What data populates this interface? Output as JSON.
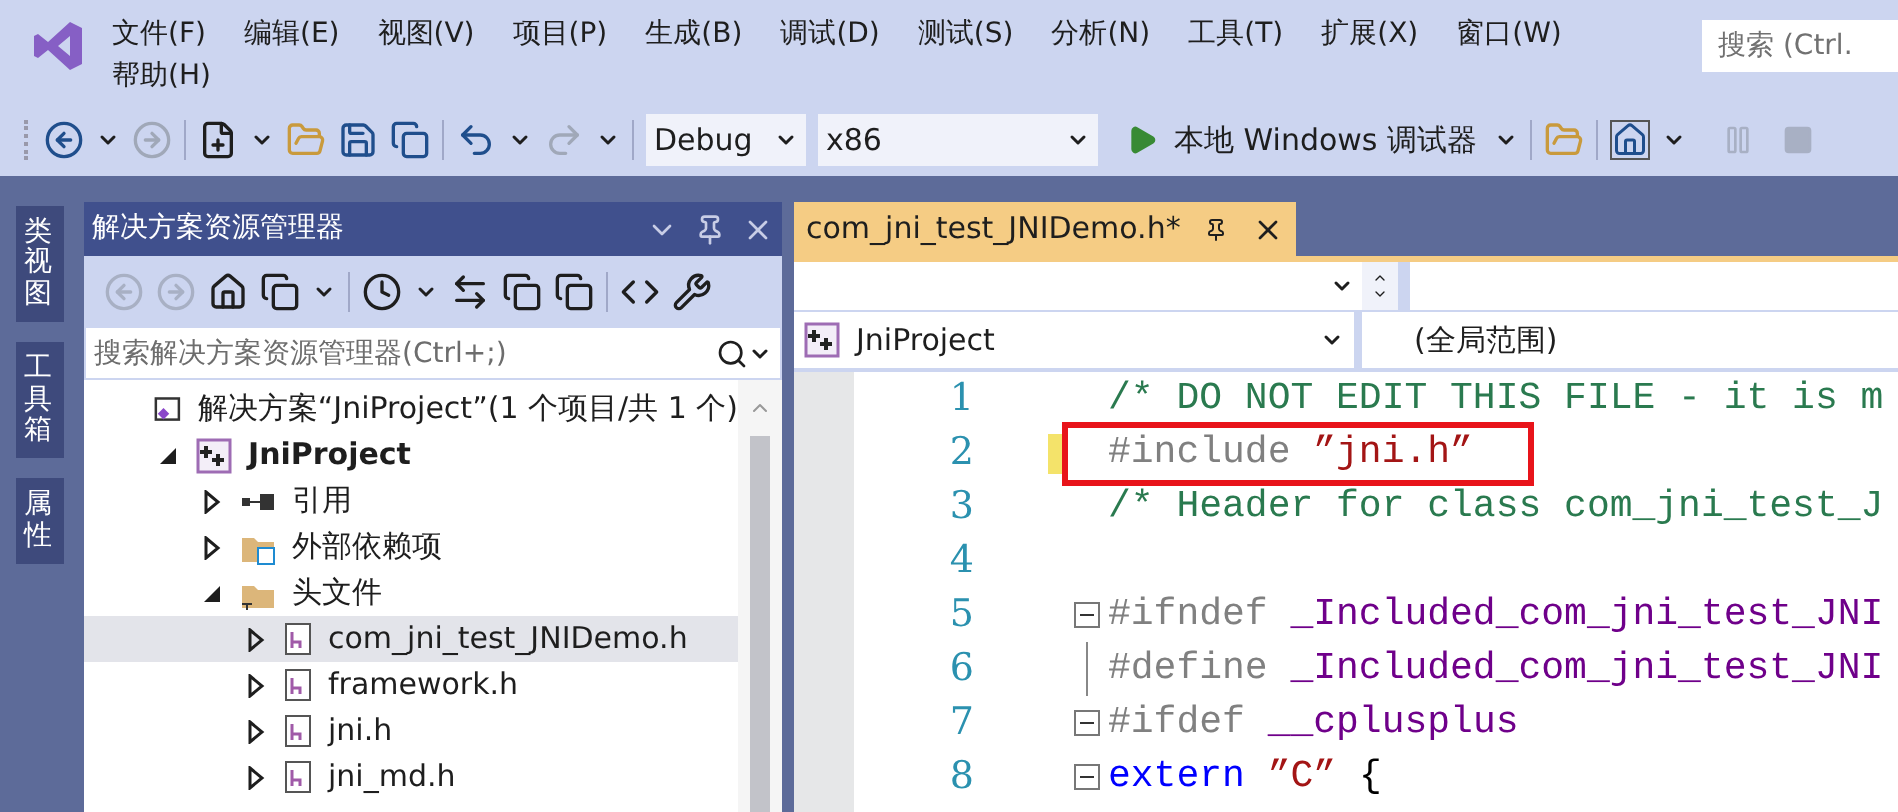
{
  "menu": [
    "文件(F)",
    "编辑(E)",
    "视图(V)",
    "项目(P)",
    "生成(B)",
    "调试(D)",
    "测试(S)",
    "分析(N)",
    "工具(T)",
    "扩展(X)",
    "窗口(W)",
    "帮助(H)"
  ],
  "search": {
    "placeholder": "搜索 (Ctrl."
  },
  "toolbar": {
    "configuration": "Debug",
    "platform": "x86",
    "run_label": "本地 Windows 调试器"
  },
  "side_tabs": [
    "类视图",
    "工具箱",
    "属性"
  ],
  "solution_explorer": {
    "title": "解决方案资源管理器",
    "search_placeholder": "搜索解决方案资源管理器(Ctrl+;)",
    "tree": [
      {
        "label": "解决方案“JniProject”(1 个项目/共 1 个)",
        "kind": "solution",
        "children": [
          {
            "label": "JniProject",
            "kind": "project",
            "expanded": true,
            "children": [
              {
                "label": "引用",
                "kind": "references",
                "expanded": false
              },
              {
                "label": "外部依赖项",
                "kind": "external",
                "expanded": false
              },
              {
                "label": "头文件",
                "kind": "folder",
                "expanded": true,
                "children": [
                  {
                    "label": "com_jni_test_JNIDemo.h",
                    "kind": "header",
                    "expanded": false,
                    "selected": true
                  },
                  {
                    "label": "framework.h",
                    "kind": "header",
                    "expanded": false,
                    "selected": false
                  },
                  {
                    "label": "jni.h",
                    "kind": "header",
                    "expanded": false,
                    "selected": false
                  },
                  {
                    "label": "jni_md.h",
                    "kind": "header",
                    "expanded": false,
                    "selected": false
                  }
                ]
              }
            ]
          }
        ]
      }
    ]
  },
  "editor": {
    "tab": {
      "title": "com_jni_test_JNIDemo.h*"
    },
    "project": "JniProject",
    "scope": "(全局范围)",
    "lines": [
      {
        "number": "1",
        "boxed": false,
        "changed": false,
        "collapsible": false,
        "fold_guide": false,
        "tokens": [
          {
            "kind": "comment",
            "text": "/* DO NOT EDIT THIS FILE - it is m"
          }
        ]
      },
      {
        "number": "2",
        "boxed": true,
        "changed": true,
        "collapsible": false,
        "fold_guide": false,
        "tokens": [
          {
            "kind": "preproc",
            "text": "#include "
          },
          {
            "kind": "string",
            "text": "”jni.h”"
          }
        ]
      },
      {
        "number": "3",
        "boxed": false,
        "changed": false,
        "collapsible": false,
        "fold_guide": false,
        "tokens": [
          {
            "kind": "comment",
            "text": "/* Header for class com_jni_test_J"
          }
        ]
      },
      {
        "number": "4",
        "boxed": false,
        "changed": false,
        "collapsible": false,
        "fold_guide": false
      },
      {
        "number": "5",
        "boxed": false,
        "changed": false,
        "collapsible": true,
        "fold_guide": false,
        "tokens": [
          {
            "kind": "preproc",
            "text": "#ifndef "
          },
          {
            "kind": "macro",
            "text": "_Included_com_jni_test_JNI"
          }
        ]
      },
      {
        "number": "6",
        "boxed": false,
        "changed": false,
        "collapsible": false,
        "fold_guide": true,
        "tokens": [
          {
            "kind": "preproc",
            "text": "#define "
          },
          {
            "kind": "macro",
            "text": "_Included_com_jni_test_JNI"
          }
        ]
      },
      {
        "number": "7",
        "boxed": false,
        "changed": false,
        "collapsible": true,
        "fold_guide": false,
        "tokens": [
          {
            "kind": "preproc",
            "text": "#ifdef "
          },
          {
            "kind": "macro",
            "text": "__cplusplus"
          }
        ]
      },
      {
        "number": "8",
        "boxed": false,
        "changed": false,
        "collapsible": true,
        "fold_guide": false,
        "tokens": [
          {
            "kind": "keyword",
            "text": "extern "
          },
          {
            "kind": "string",
            "text": "”C”"
          },
          {
            "kind": "plain",
            "text": " {"
          }
        ]
      }
    ]
  }
}
